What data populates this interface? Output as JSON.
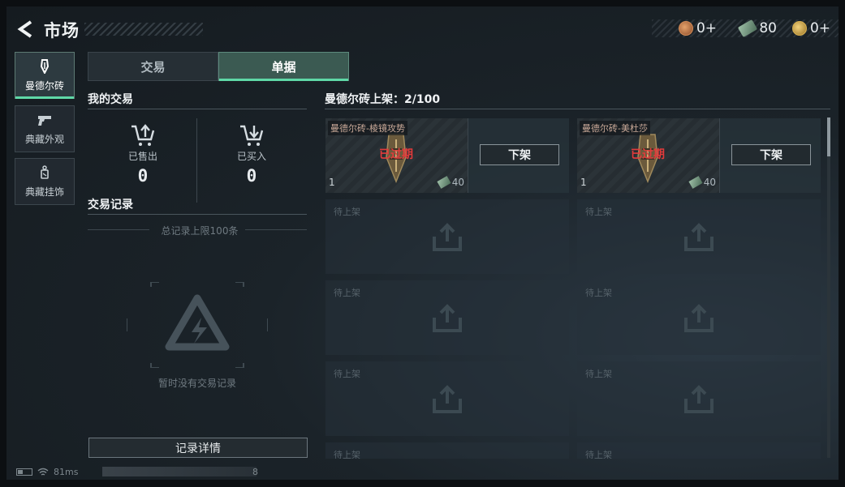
{
  "header": {
    "title": "市场",
    "currencies": [
      {
        "icon": "orange-coin-icon",
        "value": "0+"
      },
      {
        "icon": "cash-bill-icon",
        "value": "80"
      },
      {
        "icon": "gold-coin-icon",
        "value": "0+"
      }
    ]
  },
  "categories": [
    {
      "icon": "mandel-brick-icon",
      "label": "曼德尔砖",
      "active": true
    },
    {
      "icon": "pistol-icon",
      "label": "典藏外观",
      "active": false
    },
    {
      "icon": "charm-icon",
      "label": "典藏挂饰",
      "active": false
    }
  ],
  "tabs": [
    {
      "label": "交易",
      "active": false
    },
    {
      "label": "单据",
      "active": true
    }
  ],
  "my_trades": {
    "title": "我的交易",
    "sold_label": "已售出",
    "sold_value": "0",
    "bought_label": "已买入",
    "bought_value": "0"
  },
  "records": {
    "title": "交易记录",
    "limit_text": "总记录上限100条",
    "empty_text": "暂时没有交易记录",
    "detail_button": "记录详情"
  },
  "listings": {
    "title": "曼德尔砖上架：2/100",
    "items": [
      {
        "name": "曼德尔砖-棱镜攻势",
        "status": "已过期",
        "qty": "1",
        "price": "40",
        "action": "下架"
      },
      {
        "name": "曼德尔砖-美杜莎",
        "status": "已过期",
        "qty": "1",
        "price": "40",
        "action": "下架"
      }
    ],
    "pending_label": "待上架"
  },
  "status_bar": {
    "ping": "81ms",
    "extra": "8"
  },
  "colors": {
    "accent": "#5fd8a7",
    "expired": "#e23b3b"
  }
}
